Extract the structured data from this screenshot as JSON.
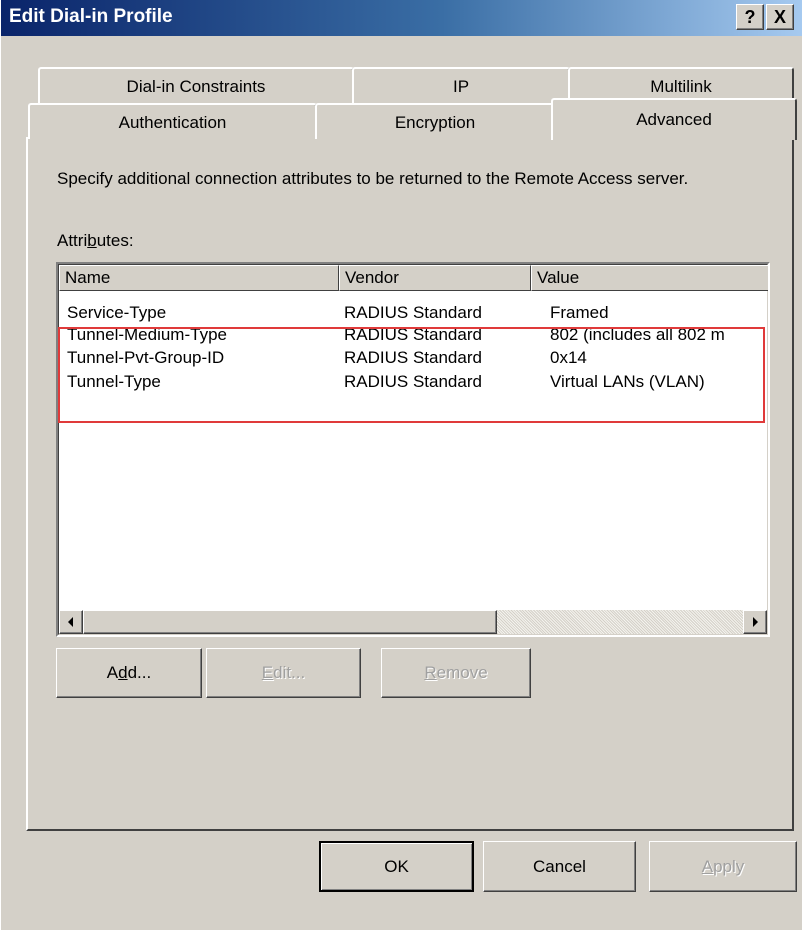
{
  "window": {
    "title": "Edit Dial-in Profile",
    "help_label": "?",
    "close_label": "X"
  },
  "tabs_row_back": [
    {
      "label": "Dial-in Constraints"
    },
    {
      "label": "IP"
    },
    {
      "label": "Multilink"
    }
  ],
  "tabs_row_front": [
    {
      "label": "Authentication"
    },
    {
      "label": "Encryption"
    },
    {
      "label": "Advanced",
      "active": true
    }
  ],
  "panel": {
    "description": "Specify additional connection attributes to be returned to the Remote Access server.",
    "attributes_label": {
      "pre": "Attri",
      "mnemonic": "b",
      "post": "utes:"
    }
  },
  "table": {
    "columns": [
      "Name",
      "Vendor",
      "Value"
    ],
    "rows": [
      {
        "name": "Service-Type",
        "vendor": "RADIUS Standard",
        "value": "Framed"
      },
      {
        "name": "Tunnel-Medium-Type",
        "vendor": "RADIUS Standard",
        "value": "802 (includes all 802 m"
      },
      {
        "name": "Tunnel-Pvt-Group-ID",
        "vendor": "RADIUS Standard",
        "value": "0x14"
      },
      {
        "name": "Tunnel-Type",
        "vendor": "RADIUS Standard",
        "value": "Virtual LANs (VLAN)"
      }
    ],
    "highlight_color": "#e03a3a"
  },
  "list_buttons": {
    "add": {
      "pre": "A",
      "mnemonic": "d",
      "post": "d..."
    },
    "edit": {
      "pre": "",
      "mnemonic": "E",
      "post": "dit..."
    },
    "remove": {
      "pre": "",
      "mnemonic": "R",
      "post": "emove"
    }
  },
  "dialog_buttons": {
    "ok": "OK",
    "cancel": "Cancel",
    "apply": {
      "pre": "",
      "mnemonic": "A",
      "post": "pply"
    }
  },
  "colors": {
    "face": "#d4d0c8",
    "title_start": "#0a246a",
    "title_end": "#a6caf0"
  }
}
